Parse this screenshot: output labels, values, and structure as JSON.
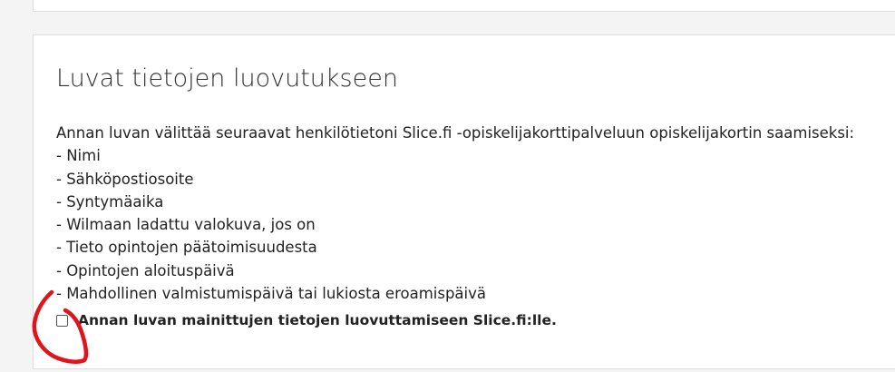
{
  "section": {
    "title": "Luvat tietojen luovutukseen",
    "intro": "Annan luvan välittää seuraavat henkilötietoni Slice.fi -opiskelijakorttipalveluun opiskelijakortin saamiseksi:",
    "items": [
      "- Nimi",
      "- Sähköpostiosoite",
      "- Syntymäaika",
      "- Wilmaan ladattu valokuva, jos on",
      "- Tieto opintojen päätoimisuudesta",
      "- Opintojen aloituspäivä",
      "- Mahdollinen valmistumispäivä tai lukiosta eroamispäivä"
    ],
    "consent_label": "Annan luvan mainittujen tietojen luovuttamiseen Slice.fi:lle.",
    "consent_checked": false
  },
  "colors": {
    "annotation": "#e0141c",
    "background": "#f4f4f4",
    "panel": "#ffffff"
  }
}
